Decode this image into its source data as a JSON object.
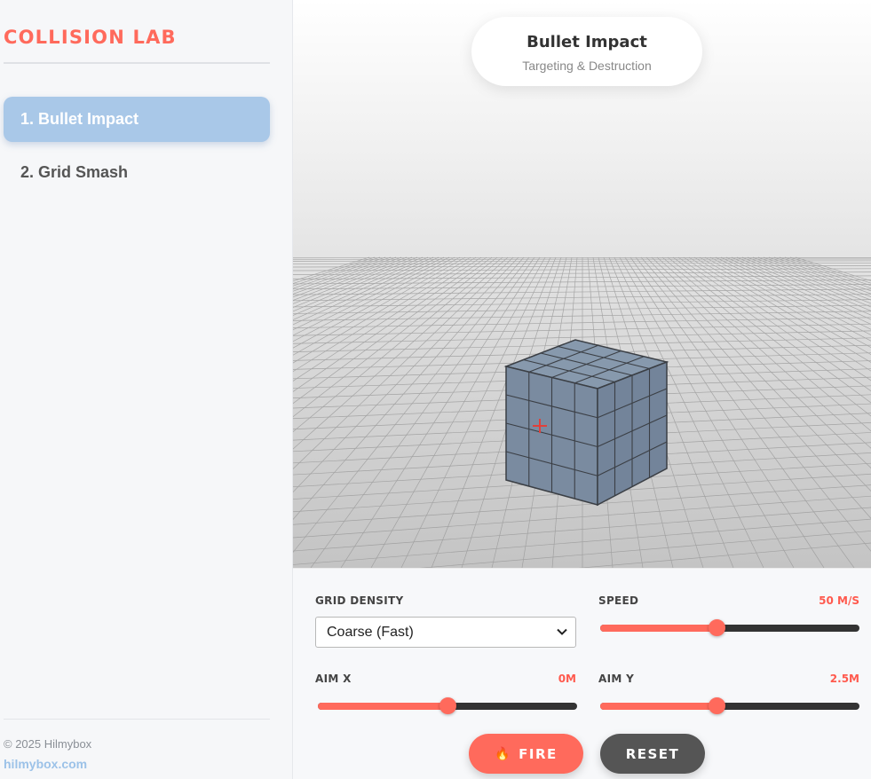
{
  "sidebar": {
    "brand": "COLLISION LAB",
    "items": [
      {
        "label": "1. Bullet Impact",
        "active": true
      },
      {
        "label": "2. Grid Smash",
        "active": false
      }
    ],
    "copyright": "© 2025 Hilmybox",
    "site": "hilmybox.com"
  },
  "header": {
    "title": "Bullet Impact",
    "subtitle": "Targeting & Destruction"
  },
  "controls": {
    "grid_density": {
      "label": "GRID DENSITY",
      "value": "Coarse (Fast)"
    },
    "speed": {
      "label": "SPEED",
      "display": "50 M/S",
      "fraction": 0.45
    },
    "aim_x": {
      "label": "AIM X",
      "display": "0M",
      "fraction": 0.5
    },
    "aim_y": {
      "label": "AIM Y",
      "display": "2.5M",
      "fraction": 0.45
    },
    "fire_label": "FIRE",
    "reset_label": "RESET"
  },
  "colors": {
    "accent": "#ff6a5c",
    "nav_active": "#a9c8e8",
    "cube": "#7f8fa3",
    "reset": "#555555"
  },
  "icons": {
    "fire": "flame-icon",
    "select": "chevron-down-icon",
    "target": "crosshair-icon"
  }
}
